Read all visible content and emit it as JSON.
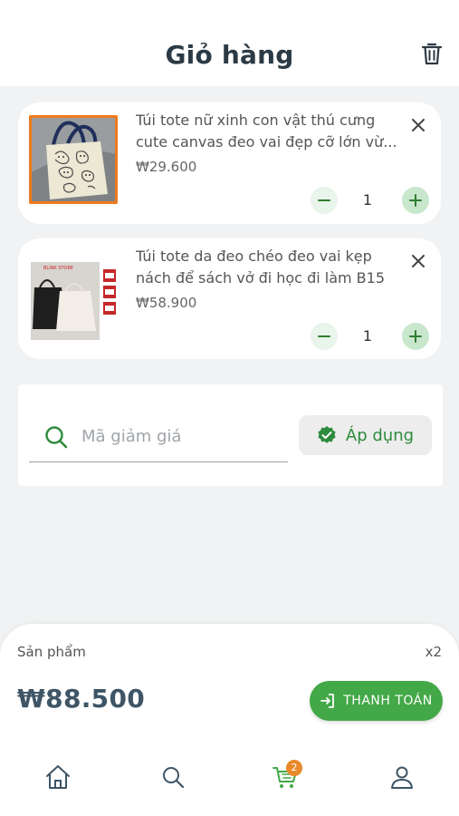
{
  "header": {
    "title": "Giỏ hàng"
  },
  "cart": {
    "items": [
      {
        "name_line1": "Túi tote nữ xinh con vật thú cưng",
        "name_line2": "cute canvas đeo vai đẹp cỡ lớn vừ...",
        "price": "₩29.600",
        "quantity": "1"
      },
      {
        "name_line1": "Túi tote da đeo chéo đeo vai kẹp",
        "name_line2": "nách để sách vở đi học đi làm B15",
        "price": "₩58.900",
        "quantity": "1",
        "image_text": "BLINK STORE"
      }
    ]
  },
  "coupon": {
    "placeholder": "Mã giảm giá",
    "value": "",
    "apply_label": "Áp dụng"
  },
  "summary": {
    "label": "Sản phẩm",
    "count": "x2",
    "total": "₩88.500",
    "checkout_label": "THANH TOÁN"
  },
  "nav": {
    "items": [
      {
        "icon": "home-icon"
      },
      {
        "icon": "search-icon"
      },
      {
        "icon": "cart-icon",
        "badge": "2"
      },
      {
        "icon": "profile-icon"
      }
    ]
  },
  "colors": {
    "accent_green": "#43a847",
    "badge_orange": "#e8892a",
    "highlight_orange": "#f07a1a"
  }
}
